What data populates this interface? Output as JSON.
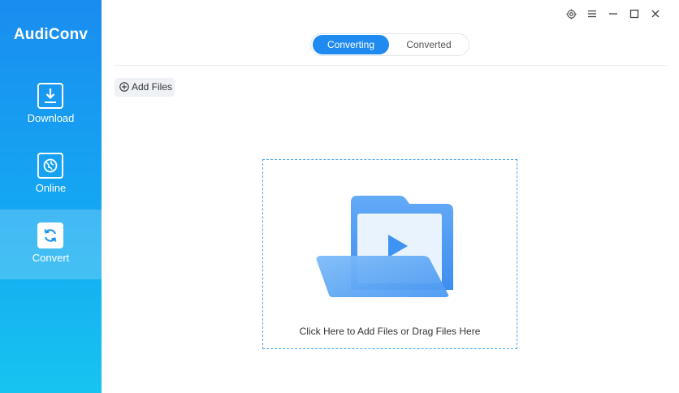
{
  "app": {
    "name": "AudiConv"
  },
  "sidebar": {
    "items": [
      {
        "label": "Download",
        "icon": "download-icon",
        "active": false
      },
      {
        "label": "Online",
        "icon": "online-music-icon",
        "active": false
      },
      {
        "label": "Convert",
        "icon": "convert-icon",
        "active": true
      }
    ]
  },
  "window_controls": [
    "settings-icon",
    "menu-icon",
    "minimize-icon",
    "maximize-icon",
    "close-icon"
  ],
  "tabs": [
    {
      "label": "Converting",
      "active": true
    },
    {
      "label": "Converted",
      "active": false
    }
  ],
  "toolbar": {
    "add_files_label": "Add Files"
  },
  "dropzone": {
    "text": "Click Here to Add Files or Drag Files Here"
  },
  "colors": {
    "accent": "#1f8bf0",
    "sidebar_top": "#1a8df0",
    "sidebar_bottom": "#17c4f0",
    "dropzone_border": "#4aa5f0"
  }
}
